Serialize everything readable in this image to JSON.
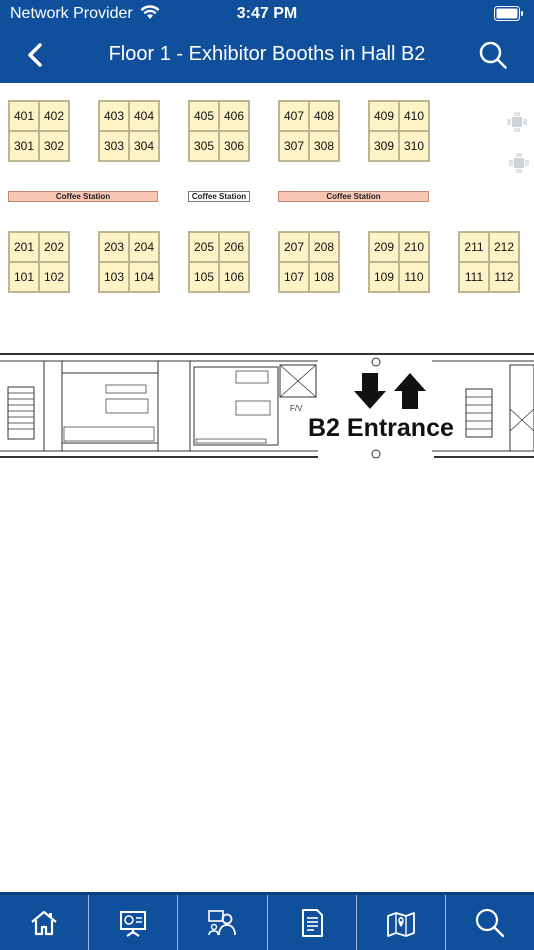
{
  "status": {
    "carrier": "Network Provider",
    "time": "3:47 PM"
  },
  "header": {
    "title": "Floor 1 - Exhibitor Booths in Hall B2"
  },
  "map": {
    "row_top": [
      {
        "booths": [
          "401",
          "402",
          "301",
          "302"
        ]
      },
      {
        "booths": [
          "403",
          "404",
          "303",
          "304"
        ]
      },
      {
        "booths": [
          "405",
          "406",
          "305",
          "306"
        ]
      },
      {
        "booths": [
          "407",
          "408",
          "307",
          "308"
        ]
      },
      {
        "booths": [
          "409",
          "410",
          "309",
          "310"
        ]
      }
    ],
    "row_bottom": [
      {
        "booths": [
          "201",
          "202",
          "101",
          "102"
        ]
      },
      {
        "booths": [
          "203",
          "204",
          "103",
          "104"
        ]
      },
      {
        "booths": [
          "205",
          "206",
          "105",
          "106"
        ]
      },
      {
        "booths": [
          "207",
          "208",
          "107",
          "108"
        ]
      },
      {
        "booths": [
          "209",
          "210",
          "109",
          "110"
        ]
      },
      {
        "booths": [
          "211",
          "212",
          "111",
          "112"
        ]
      }
    ],
    "coffee_stations": [
      "Coffee Station",
      "Coffee Station",
      "Coffee Station"
    ],
    "entrance_label": "B2 Entrance"
  },
  "tabs": [
    {
      "icon": "home-icon"
    },
    {
      "icon": "presentation-icon"
    },
    {
      "icon": "speakers-icon"
    },
    {
      "icon": "document-icon"
    },
    {
      "icon": "map-icon"
    },
    {
      "icon": "search-icon"
    }
  ],
  "colors": {
    "brand": "#0f4f9c",
    "booth_fill": "#fdf3c7",
    "coffee_fill": "#f8c6b3"
  }
}
